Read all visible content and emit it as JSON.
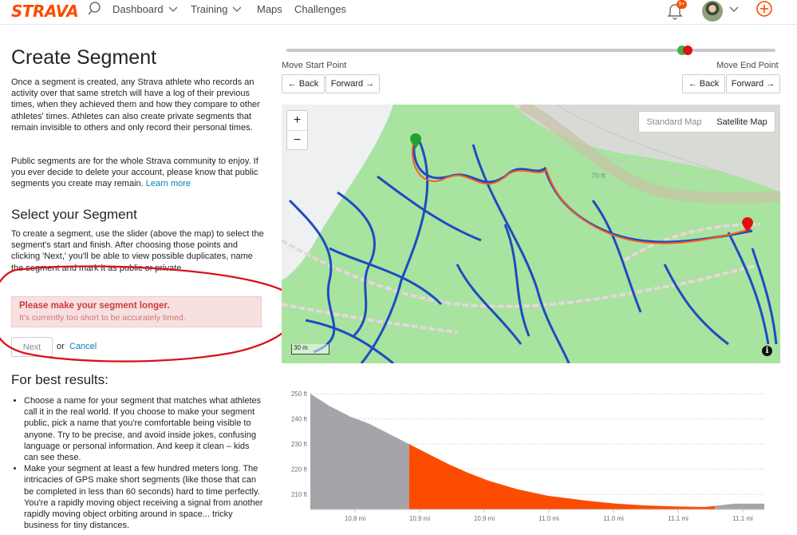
{
  "nav": {
    "logo": "STRAVA",
    "items": [
      {
        "label": "Dashboard",
        "has_menu": true
      },
      {
        "label": "Training",
        "has_menu": true
      },
      {
        "label": "Maps",
        "has_menu": false
      },
      {
        "label": "Challenges",
        "has_menu": false
      }
    ],
    "notification_badge": "9+",
    "accent_color": "#fc4c02"
  },
  "page": {
    "title": "Create Segment",
    "intro": "Once a segment is created, any Strava athlete who records an activity over that same stretch will have a log of their previous times, when they achieved them and how they compare to other athletes' times. Athletes can also create private segments that remain invisible to others and only record their personal times.",
    "public_note": "Public segments are for the whole Strava community to enjoy. If you ever decide to delete your account, please know that public segments you create may remain.",
    "learn_more": "Learn more",
    "select_heading": "Select your Segment",
    "select_text": "To create a segment, use the slider (above the map) to select the segment's start and finish. After choosing those points and clicking 'Next,' you'll be able to view possible duplicates, name the segment and mark it as public or private.",
    "alert_title": "Please make your segment longer.",
    "alert_text": "It's currently too short to be accurately timed.",
    "next_label": "Next",
    "or_label": "or",
    "cancel_label": "Cancel",
    "best_heading": "For best results:",
    "tips": [
      "Choose a name for your segment that matches what athletes call it in the real world. If you choose to make your segment public, pick a name that you're comfortable being visible to anyone. Try to be precise, and avoid inside jokes, confusing language or personal information. And keep it clean – kids can see these.",
      "Make your segment at least a few hundred meters long. The intricacies of GPS make short segments (like those that can be completed in less than 60 seconds) hard to time perfectly. You're a rapidly moving object receiving a signal from another rapidly moving object orbiting around in space... tricky business for tiny distances."
    ]
  },
  "controls": {
    "move_start_label": "Move Start Point",
    "move_end_label": "Move End Point",
    "back_label": "← Back",
    "forward_label": "Forward →",
    "start_position": 0.84,
    "end_position": 0.86
  },
  "map": {
    "zoom_in": "+",
    "zoom_out": "−",
    "standard_label": "Standard Map",
    "satellite_label": "Satellite Map",
    "contour_label": "70 ft",
    "scale_label": "30 m",
    "info_icon": "info-icon"
  },
  "chart_data": {
    "type": "area",
    "title": "",
    "xlabel": "",
    "ylabel": "",
    "x_unit": "mi",
    "y_unit": "ft",
    "xlim": [
      10.72,
      11.18
    ],
    "ylim": [
      204,
      251
    ],
    "x_ticks": [
      "10.8 mi",
      "10.9 mi",
      "10.9 mi",
      "11.0 mi",
      "11.0 mi",
      "11.1 mi",
      "11.1 mi"
    ],
    "y_ticks": [
      "250 ft",
      "240 ft",
      "230 ft",
      "220 ft",
      "210 ft"
    ],
    "y_tick_values": [
      250,
      240,
      230,
      220,
      210
    ],
    "grid": true,
    "series": [
      {
        "color": "#fc4c02",
        "x": [
          10.72,
          10.74,
          10.76,
          10.78,
          10.79,
          10.8,
          10.81,
          10.82,
          10.84,
          10.86,
          10.88,
          10.9,
          10.93,
          10.96,
          11.0,
          11.03,
          11.06,
          11.09,
          11.12,
          11.15,
          11.18
        ],
        "y": [
          250,
          245,
          241,
          238,
          236,
          234,
          232,
          230,
          226,
          222,
          218.5,
          215.5,
          212,
          209.5,
          207.5,
          206.3,
          205.6,
          205.2,
          205,
          206.3,
          206.3
        ]
      }
    ],
    "selection": {
      "start": 10.82,
      "end": 11.13,
      "selected_color": "#fc4c02",
      "unselected_color": "#a5a5a9"
    }
  }
}
